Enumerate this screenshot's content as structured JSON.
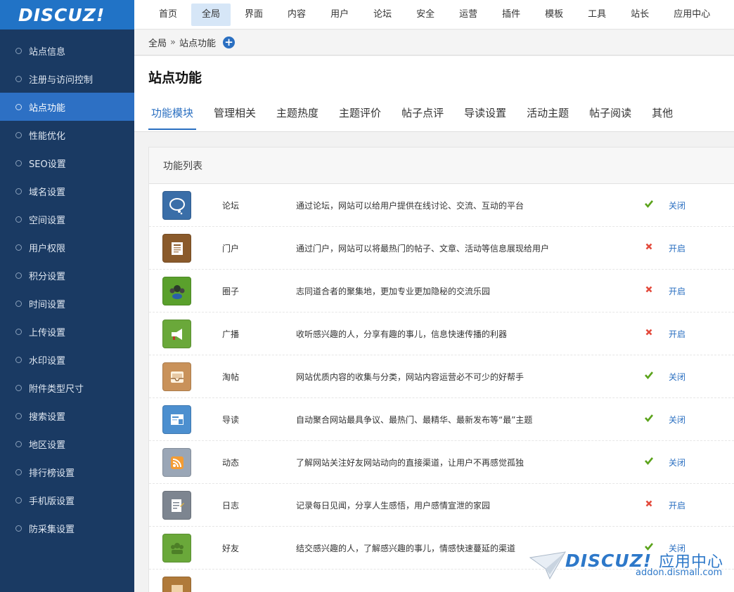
{
  "app": {
    "logo": "DISCUZ!"
  },
  "sidebar": {
    "items": [
      {
        "label": "站点信息",
        "active": false
      },
      {
        "label": "注册与访问控制",
        "active": false
      },
      {
        "label": "站点功能",
        "active": true
      },
      {
        "label": "性能优化",
        "active": false
      },
      {
        "label": "SEO设置",
        "active": false
      },
      {
        "label": "域名设置",
        "active": false
      },
      {
        "label": "空间设置",
        "active": false
      },
      {
        "label": "用户权限",
        "active": false
      },
      {
        "label": "积分设置",
        "active": false
      },
      {
        "label": "时间设置",
        "active": false
      },
      {
        "label": "上传设置",
        "active": false
      },
      {
        "label": "水印设置",
        "active": false
      },
      {
        "label": "附件类型尺寸",
        "active": false
      },
      {
        "label": "搜索设置",
        "active": false
      },
      {
        "label": "地区设置",
        "active": false
      },
      {
        "label": "排行榜设置",
        "active": false
      },
      {
        "label": "手机版设置",
        "active": false
      },
      {
        "label": "防采集设置",
        "active": false
      }
    ]
  },
  "topnav": {
    "items": [
      {
        "label": "首页",
        "active": false
      },
      {
        "label": "全局",
        "active": true
      },
      {
        "label": "界面",
        "active": false
      },
      {
        "label": "内容",
        "active": false
      },
      {
        "label": "用户",
        "active": false
      },
      {
        "label": "论坛",
        "active": false
      },
      {
        "label": "安全",
        "active": false
      },
      {
        "label": "运营",
        "active": false
      },
      {
        "label": "插件",
        "active": false
      },
      {
        "label": "模板",
        "active": false
      },
      {
        "label": "工具",
        "active": false
      },
      {
        "label": "站长",
        "active": false
      },
      {
        "label": "应用中心",
        "active": false
      }
    ]
  },
  "breadcrumb": {
    "root": "全局",
    "separator": "»",
    "current": "站点功能",
    "add_icon": "plus-circle-icon"
  },
  "page": {
    "title": "站点功能"
  },
  "tabs": [
    {
      "label": "功能模块",
      "active": true
    },
    {
      "label": "管理相关",
      "active": false
    },
    {
      "label": "主题热度",
      "active": false
    },
    {
      "label": "主题评价",
      "active": false
    },
    {
      "label": "帖子点评",
      "active": false
    },
    {
      "label": "导读设置",
      "active": false
    },
    {
      "label": "活动主题",
      "active": false
    },
    {
      "label": "帖子阅读",
      "active": false
    },
    {
      "label": "其他",
      "active": false
    }
  ],
  "panel": {
    "title": "功能列表",
    "features": [
      {
        "name": "论坛",
        "desc": "通过论坛，网站可以给用户提供在线讨论、交流、互动的平台",
        "enabled": true,
        "action": "关闭",
        "icon": "speech-bubble-icon",
        "color": "#3a6ea8"
      },
      {
        "name": "门户",
        "desc": "通过门户，网站可以将最热门的帖子、文章、活动等信息展现给用户",
        "enabled": false,
        "action": "开启",
        "icon": "newspaper-icon",
        "color": "#8a5a2b"
      },
      {
        "name": "圈子",
        "desc": "志同道合者的聚集地，更加专业更加隐秘的交流乐园",
        "enabled": false,
        "action": "开启",
        "icon": "group-icon",
        "color": "#5aa02c"
      },
      {
        "name": "广播",
        "desc": "收听感兴趣的人，分享有趣的事儿，信息快速传播的利器",
        "enabled": false,
        "action": "开启",
        "icon": "megaphone-icon",
        "color": "#6aa83a"
      },
      {
        "name": "淘帖",
        "desc": "网站优质内容的收集与分类，网站内容运营必不可少的好帮手",
        "enabled": true,
        "action": "关闭",
        "icon": "tray-icon",
        "color": "#c9925a"
      },
      {
        "name": "导读",
        "desc": "自动聚合网站最具争议、最热门、最精华、最新发布等“最”主题",
        "enabled": true,
        "action": "关闭",
        "icon": "guide-icon",
        "color": "#4c8fcf"
      },
      {
        "name": "动态",
        "desc": "了解网站关注好友网站动向的直接渠道，让用户不再感觉孤独",
        "enabled": true,
        "action": "关闭",
        "icon": "rss-icon",
        "color": "#9aa6b6"
      },
      {
        "name": "日志",
        "desc": "记录每日见闻，分享人生感悟，用户感情宣泄的家园",
        "enabled": false,
        "action": "开启",
        "icon": "notepad-icon",
        "color": "#7d8590"
      },
      {
        "name": "好友",
        "desc": "结交感兴趣的人，了解感兴趣的事儿，情感快速蔓延的渠道",
        "enabled": true,
        "action": "关闭",
        "icon": "friends-icon",
        "color": "#6aa83a"
      },
      {
        "name": "",
        "desc": "",
        "enabled": null,
        "action": "",
        "icon": "album-icon",
        "color": "#b07a3a"
      }
    ]
  },
  "watermark": {
    "brand": "DISCUZ!",
    "cn": "应用中心",
    "domain": "addon.dismall.com"
  }
}
